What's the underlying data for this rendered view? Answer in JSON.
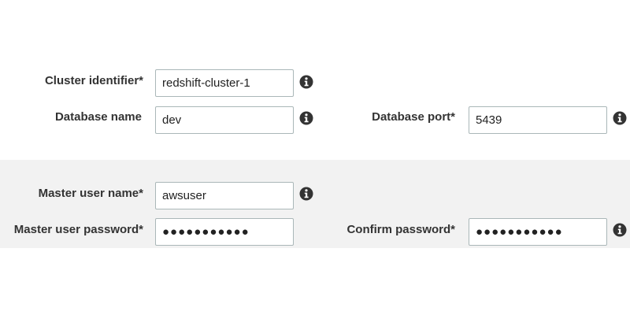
{
  "cluster": {
    "identifier_label": "Cluster identifier*",
    "identifier_value": "redshift-cluster-1",
    "database_name_label": "Database name",
    "database_name_value": "dev",
    "database_port_label": "Database port*",
    "database_port_value": "5439"
  },
  "credentials": {
    "master_user_label": "Master user name*",
    "master_user_value": "awsuser",
    "master_password_label": "Master user password*",
    "master_password_value": "●●●●●●●●●●●",
    "confirm_password_label": "Confirm password*",
    "confirm_password_value": "●●●●●●●●●●●"
  },
  "icons": {
    "info": "info-circle-icon"
  },
  "colors": {
    "section_band": "#f2f2f2",
    "input_border": "#aab7b8",
    "label_text": "#333333",
    "info_icon": "#333333"
  }
}
